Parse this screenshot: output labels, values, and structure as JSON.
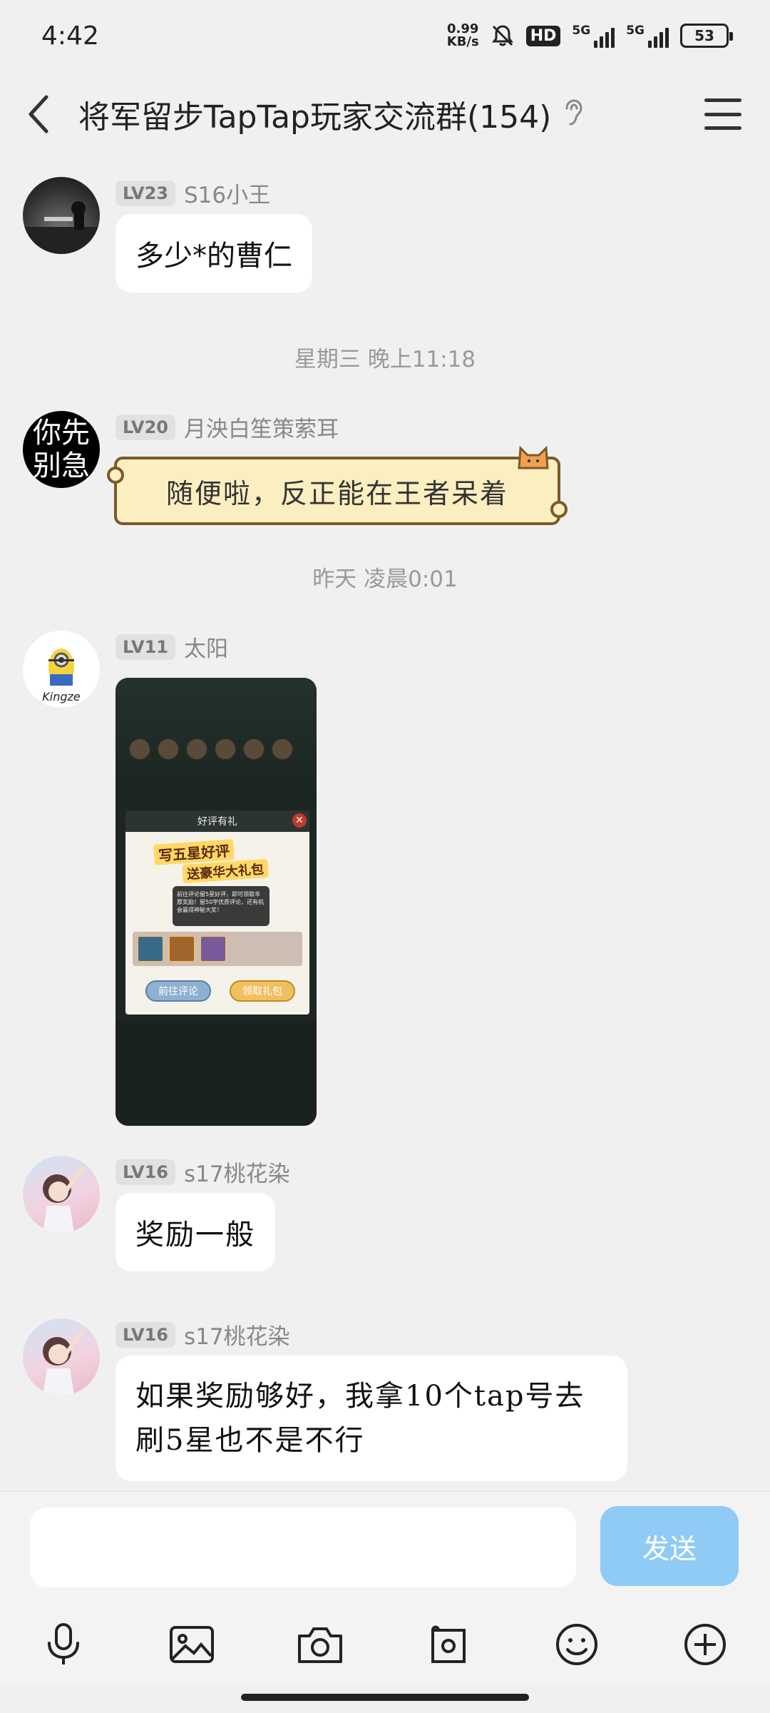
{
  "status_bar": {
    "time": "4:42",
    "net_speed_value": "0.99",
    "net_speed_unit": "KB/s",
    "hd_label": "HD",
    "sim1_label": "5G",
    "sim2_label": "5G",
    "battery": "53"
  },
  "header": {
    "title": "将军留步TapTap玩家交流群(154)"
  },
  "messages": [
    {
      "level": "LV23",
      "sender": "S16小王",
      "text": "多少*的曹仁"
    },
    {
      "timestamp": "星期三 晚上11:18"
    },
    {
      "level": "LV20",
      "sender": "月泱白笙策萦耳",
      "text": "随便啦，反正能在王者呆着",
      "avatar_text_1": "你先",
      "avatar_text_2": "别急"
    },
    {
      "timestamp": "昨天 凌晨0:01"
    },
    {
      "level": "LV11",
      "sender": "太阳",
      "avatar_text": "Kingze",
      "image": {
        "popup_header": "好评有礼",
        "title_line1": "写五星好评",
        "title_line2": "送豪华大礼包",
        "note": "前往评论留5星好评，即可领取丰厚奖励！留50字优质评论，还有机会赢得神秘大奖！",
        "btn_left": "前往评论",
        "btn_right": "领取礼包"
      }
    },
    {
      "level": "LV16",
      "sender": "s17桃花染",
      "text": "奖励一般"
    },
    {
      "level": "LV16",
      "sender": "s17桃花染",
      "text_line1": "如果奖励够好，我拿10个tap号去",
      "text_line2": "刷5星也不是不行"
    }
  ],
  "composer": {
    "placeholder": "",
    "send_label": "发送"
  },
  "colors": {
    "background": "#f0f0f0",
    "bubble": "#ffffff",
    "send_button": "#8fcbf5",
    "fancy_bubble": "#fbeec0"
  },
  "icons": [
    "back-arrow-icon",
    "ear-icon",
    "menu-icon",
    "microphone-icon",
    "image-icon",
    "camera-icon",
    "sticker-icon",
    "emoji-icon",
    "plus-icon"
  ]
}
